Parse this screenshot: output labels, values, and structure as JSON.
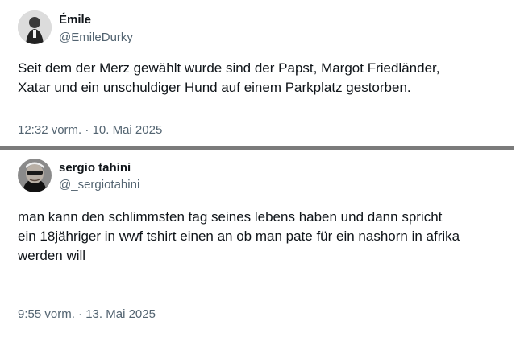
{
  "tweets": [
    {
      "display_name": "Émile",
      "handle": "@EmileDurky",
      "text_lines": [
        "Seit dem der Merz gewählt wurde sind der Papst, Margot Friedländer,",
        "Xatar und ein unschuldiger Hund auf einem Parkplatz gestorben."
      ],
      "time": "12:32 vorm.",
      "separator": " · ",
      "date": "10. Mai 2025"
    },
    {
      "display_name": "sergio tahini",
      "handle": "@_sergiotahini",
      "text_lines": [
        "man kann den schlimmsten tag seines lebens haben und dann spricht",
        "ein 18jähriger in wwf tshirt einen an ob man pate für ein nashorn in afrika",
        "werden will"
      ],
      "time": "9:55 vorm.",
      "separator": " · ",
      "date": "13. Mai 2025"
    }
  ],
  "colors": {
    "text": "#0f1419",
    "secondary": "#536471",
    "divider": "#7b7b7b"
  }
}
